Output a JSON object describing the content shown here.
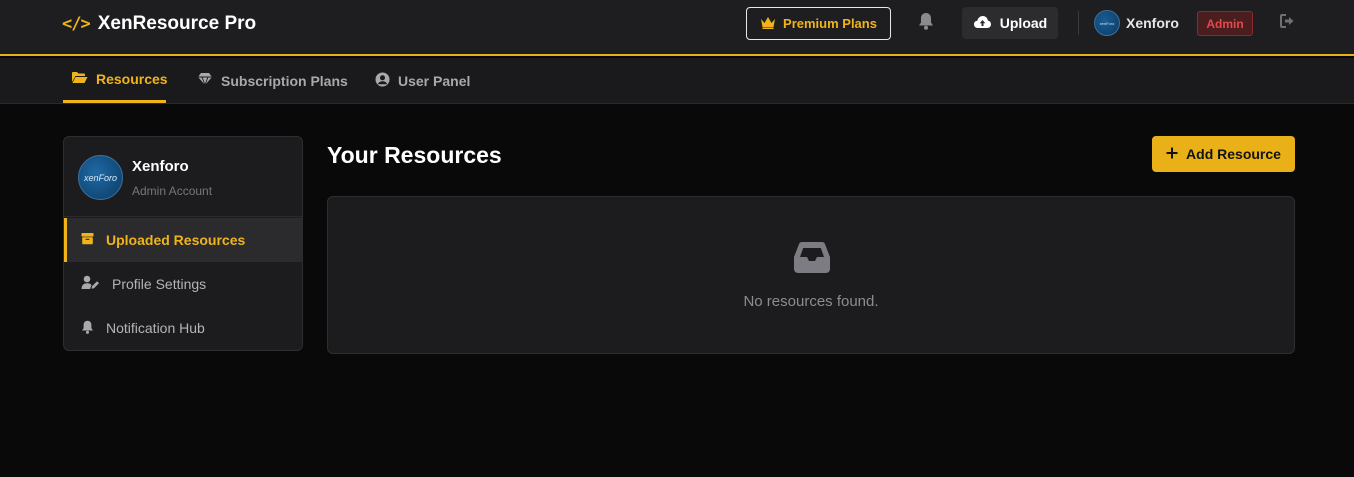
{
  "header": {
    "brand_icon": "</>",
    "brand_name": "XenResource Pro",
    "premium_label": "Premium Plans",
    "upload_label": "Upload",
    "user_name": "Xenforo",
    "avatar_text": "xenForo",
    "role_badge": "Admin",
    "icons": [
      "crown-icon",
      "bell-icon",
      "cloud-upload-icon",
      "logout-icon"
    ]
  },
  "nav": {
    "tabs": [
      {
        "label": "Resources",
        "icon": "folder-open-icon",
        "active": true
      },
      {
        "label": "Subscription Plans",
        "icon": "gem-icon",
        "active": false
      },
      {
        "label": "User Panel",
        "icon": "user-circle-icon",
        "active": false
      }
    ]
  },
  "sidebar": {
    "profile_name": "Xenforo",
    "profile_role": "Admin Account",
    "avatar_text": "xenForo",
    "items": [
      {
        "label": "Uploaded Resources",
        "icon": "box-icon",
        "active": true
      },
      {
        "label": "Profile Settings",
        "icon": "user-edit-icon",
        "active": false
      },
      {
        "label": "Notification Hub",
        "icon": "bell-icon",
        "active": false
      }
    ]
  },
  "main": {
    "title": "Your Resources",
    "add_button": "Add Resource",
    "empty_text": "No resources found."
  },
  "colors": {
    "accent": "#e9b117",
    "background": "#09090a",
    "panel": "#1c1c1e",
    "danger": "#e5484d"
  }
}
